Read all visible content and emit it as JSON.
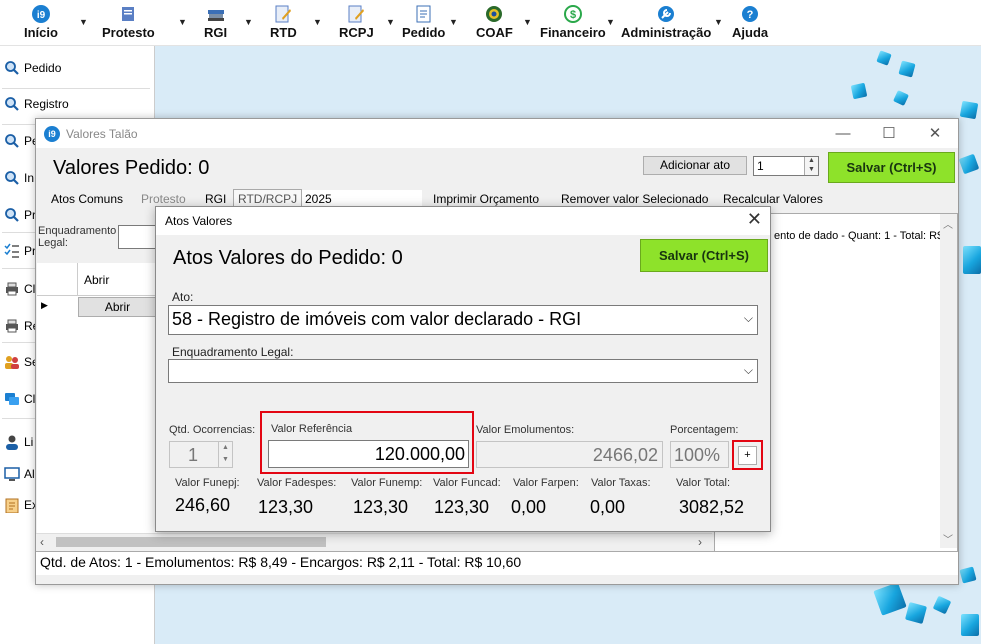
{
  "ribbon": {
    "items": [
      {
        "label": "Início",
        "icon": "i9-logo-icon"
      },
      {
        "label": "Protesto",
        "icon": "document-stack-icon"
      },
      {
        "label": "RGI",
        "icon": "books-icon"
      },
      {
        "label": "RTD",
        "icon": "pencil-document-icon"
      },
      {
        "label": "RCPJ",
        "icon": "pencil-document-icon"
      },
      {
        "label": "Pedido",
        "icon": "edit-document-icon"
      },
      {
        "label": "COAF",
        "icon": "emblem-icon"
      },
      {
        "label": "Financeiro",
        "icon": "dollar-circle-icon"
      },
      {
        "label": "Administração",
        "icon": "wrench-gear-icon"
      },
      {
        "label": "Ajuda",
        "icon": "help-icon"
      }
    ]
  },
  "sidenav": {
    "items": [
      {
        "label": "Pedido",
        "icon": "search-icon"
      },
      {
        "label": "Registro",
        "icon": "search-icon"
      },
      {
        "label": "Pe",
        "icon": "search-icon"
      },
      {
        "label": "In",
        "icon": "search-icon"
      },
      {
        "label": "Pr",
        "icon": "search-icon"
      },
      {
        "label": "Pr",
        "icon": "checklist-icon"
      },
      {
        "label": "Cl",
        "icon": "printer-icon"
      },
      {
        "label": "Re",
        "icon": "printer-icon"
      },
      {
        "label": "Se",
        "icon": "users-icon"
      },
      {
        "label": "Cl",
        "icon": "chat-icon"
      },
      {
        "label": "Li",
        "icon": "user-icon"
      },
      {
        "label": "Al",
        "icon": "monitor-icon"
      },
      {
        "label": "Ex",
        "icon": "clipboard-icon"
      }
    ]
  },
  "window": {
    "title": "Valores Talão",
    "heading": "Valores Pedido: 0",
    "add_act_label": "Adicionar ato",
    "quantity_value": "1",
    "save_label": "Salvar (Ctrl+S)",
    "tabs": [
      "Atos Comuns",
      "Protesto",
      "RGI",
      "RTD/RCPJ"
    ],
    "year_value": "2025",
    "toolbar": [
      "Imprimir Orçamento",
      "Remover valor Selecionado",
      "Recalcular Valores"
    ],
    "enquadramento_label_1": "Enquadramento",
    "enquadramento_label_2": "Legal:",
    "grid_header": "Abrir",
    "grid_button": "Abrir",
    "right_text": "ento de dado -  Quant: 1 - Total: R$",
    "status": "Qtd. de Atos: 1  -   Emolumentos: R$ 8,49   -   Encargos: R$ 2,11   -   Total: R$ 10,60"
  },
  "dialog": {
    "title": "Atos Valores",
    "heading": "Atos Valores do Pedido: 0",
    "save_label": "Salvar (Ctrl+S)",
    "ato_label": "Ato:",
    "ato_value": "58 - Registro de imóveis com valor declarado - RGI",
    "enquadramento_label": "Enquadramento Legal:",
    "enquadramento_value": "",
    "qtd_label": "Qtd. Ocorrencias:",
    "qtd_value": "1",
    "valor_referencia_label": "Valor Referência",
    "valor_referencia_value": "120.000,00",
    "valor_emolumentos_label": "Valor Emolumentos:",
    "valor_emolumentos_value": "2466,02",
    "porcentagem_label": "Porcentagem:",
    "porcentagem_value": "100%",
    "plus_label": "+",
    "fees": [
      {
        "label": "Valor Funepj:",
        "value": "246,60"
      },
      {
        "label": "Valor Fadespes:",
        "value": "123,30"
      },
      {
        "label": "Valor Funemp:",
        "value": "123,30"
      },
      {
        "label": "Valor Funcad:",
        "value": "123,30"
      },
      {
        "label": "Valor Farpen:",
        "value": "0,00"
      },
      {
        "label": "Valor Taxas:",
        "value": "0,00"
      },
      {
        "label": "Valor Total:",
        "value": "3082,52"
      }
    ]
  },
  "colors": {
    "accent_green": "#8ee22a",
    "highlight_red": "#e30613",
    "brand_blue": "#1b7fd1"
  }
}
